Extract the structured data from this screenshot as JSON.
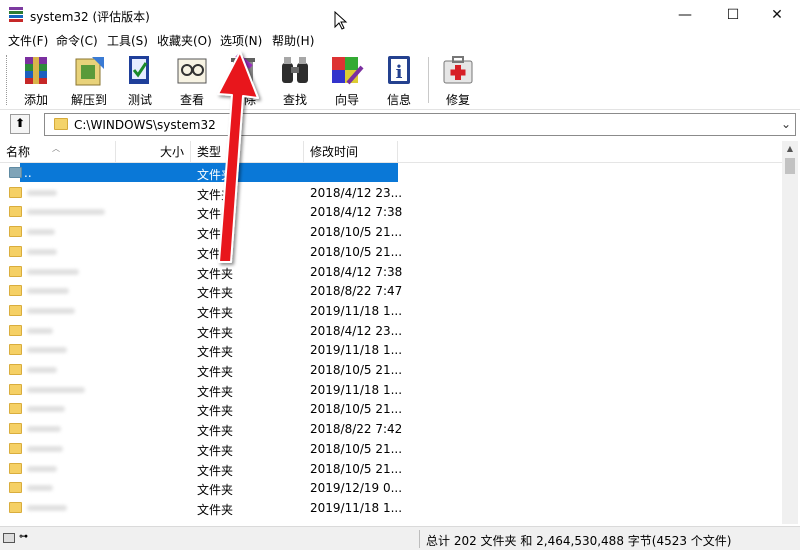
{
  "window": {
    "title": "system32 (评估版本)",
    "controls": [
      "—",
      "☐",
      "✕"
    ]
  },
  "menu": [
    "文件(F)",
    "命令(C)",
    "工具(S)",
    "收藏夹(O)",
    "选项(N)",
    "帮助(H)"
  ],
  "toolbar": [
    {
      "label": "添加",
      "icon": "add-archive-icon"
    },
    {
      "label": "解压到",
      "icon": "extract-icon"
    },
    {
      "label": "测试",
      "icon": "test-icon"
    },
    {
      "label": "查看",
      "icon": "view-icon"
    },
    {
      "label": "删除",
      "icon": "delete-icon"
    },
    {
      "label": "查找",
      "icon": "find-icon"
    },
    {
      "label": "向导",
      "icon": "wizard-icon"
    },
    {
      "label": "信息",
      "icon": "info-icon"
    },
    {
      "label": "修复",
      "icon": "repair-icon"
    }
  ],
  "address": {
    "up_label": "⬆",
    "path": "C:\\WINDOWS\\system32",
    "dropdown": "⌄"
  },
  "columns": [
    "名称",
    "大小",
    "类型",
    "修改时间"
  ],
  "rows": [
    {
      "name": "..",
      "type": "文件夹",
      "modified": "",
      "selected": true
    },
    {
      "name": "",
      "type": "文件夹",
      "modified": "2018/4/12 23...",
      "selected": false
    },
    {
      "name": "",
      "type": "文件夹",
      "modified": "2018/4/12 7:38",
      "selected": false
    },
    {
      "name": "",
      "type": "文件夹",
      "modified": "2018/10/5 21...",
      "selected": false
    },
    {
      "name": "",
      "type": "文件夹",
      "modified": "2018/10/5 21...",
      "selected": false
    },
    {
      "name": "",
      "type": "文件夹",
      "modified": "2018/4/12 7:38",
      "selected": false
    },
    {
      "name": "",
      "type": "文件夹",
      "modified": "2018/8/22 7:47",
      "selected": false
    },
    {
      "name": "",
      "type": "文件夹",
      "modified": "2019/11/18 1...",
      "selected": false
    },
    {
      "name": "",
      "type": "文件夹",
      "modified": "2018/4/12 23...",
      "selected": false
    },
    {
      "name": "",
      "type": "文件夹",
      "modified": "2019/11/18 1...",
      "selected": false
    },
    {
      "name": "",
      "type": "文件夹",
      "modified": "2018/10/5 21...",
      "selected": false
    },
    {
      "name": "",
      "type": "文件夹",
      "modified": "2019/11/18 1...",
      "selected": false
    },
    {
      "name": "",
      "type": "文件夹",
      "modified": "2018/10/5 21...",
      "selected": false
    },
    {
      "name": "",
      "type": "文件夹",
      "modified": "2018/8/22 7:42",
      "selected": false
    },
    {
      "name": "",
      "type": "文件夹",
      "modified": "2018/10/5 21...",
      "selected": false
    },
    {
      "name": "",
      "type": "文件夹",
      "modified": "2018/10/5 21...",
      "selected": false
    },
    {
      "name": "",
      "type": "文件夹",
      "modified": "2019/12/19 0...",
      "selected": false
    },
    {
      "name": "",
      "type": "文件夹",
      "modified": "2019/11/18 1...",
      "selected": false
    }
  ],
  "status": {
    "text": "总计 202 文件夹 和 2,464,530,488 字节(4523 个文件)",
    "key_label": "⊶"
  },
  "colors": {
    "selection": "#0a78d7",
    "annotation_arrow": "#e8141b",
    "folder": "#f5d065"
  }
}
